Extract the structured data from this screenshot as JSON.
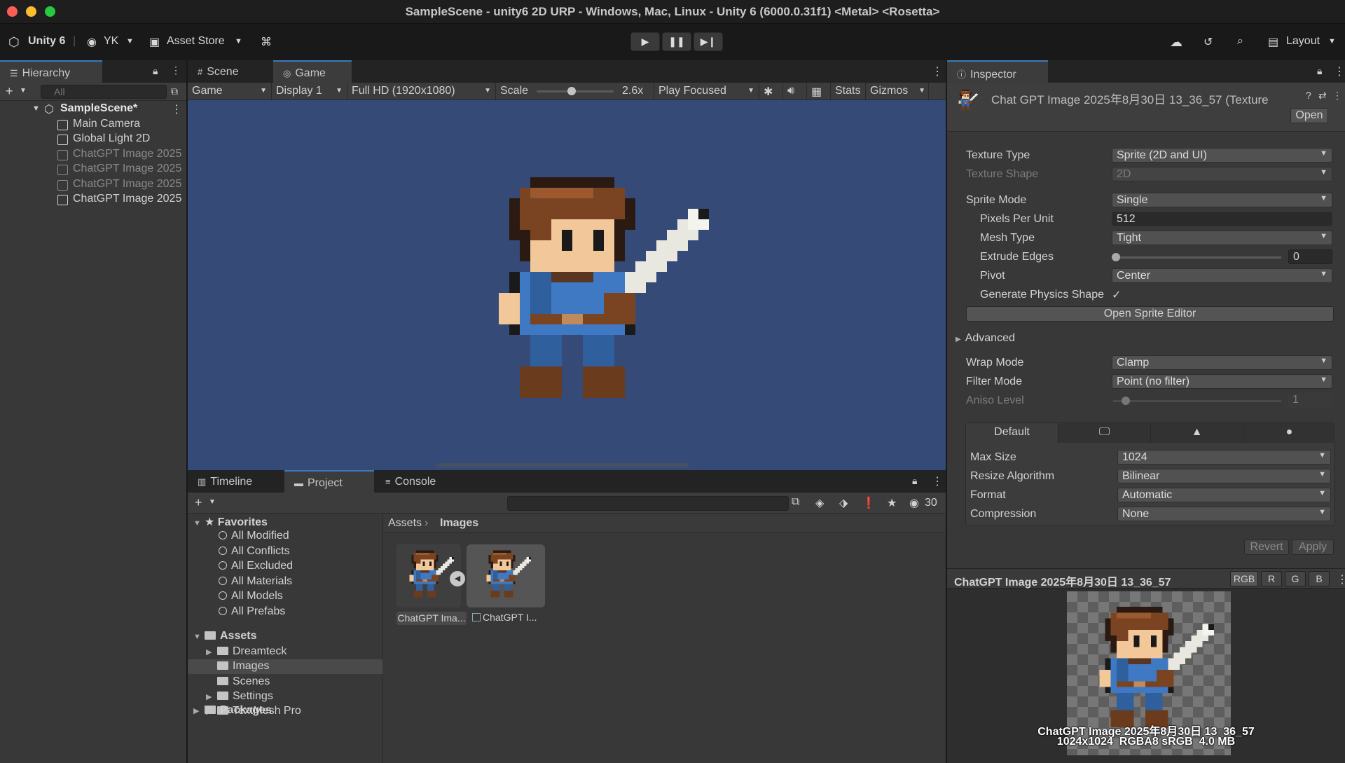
{
  "window": {
    "title": "SampleScene - unity6 2D URP - Windows, Mac, Linux - Unity 6 (6000.0.31f1) <Metal> <Rosetta>"
  },
  "toolbar": {
    "unity_label": "Unity 6",
    "account_label": "YK",
    "asset_store_label": "Asset Store",
    "layout_label": "Layout"
  },
  "hierarchy": {
    "tab_label": "Hierarchy",
    "search_placeholder": "All",
    "scene_name": "SampleScene*",
    "items": [
      {
        "label": "Main Camera",
        "dim": false
      },
      {
        "label": "Global Light 2D",
        "dim": false
      },
      {
        "label": "ChatGPT Image 2025",
        "dim": true
      },
      {
        "label": "ChatGPT Image 2025",
        "dim": true
      },
      {
        "label": "ChatGPT Image 2025",
        "dim": true
      },
      {
        "label": "ChatGPT Image 2025",
        "dim": false
      }
    ]
  },
  "center_tabs": {
    "scene": "Scene",
    "game": "Game"
  },
  "game_bar": {
    "view": "Game",
    "display": "Display 1",
    "resolution": "Full HD (1920x1080)",
    "scale_label": "Scale",
    "scale_value": "2.6x",
    "scale_fraction": 0.45,
    "play_mode": "Play Focused",
    "stats": "Stats",
    "gizmos": "Gizmos"
  },
  "bottom_tabs": {
    "timeline": "Timeline",
    "project": "Project",
    "console": "Console",
    "hidden_count": "30"
  },
  "project": {
    "favorites_label": "Favorites",
    "favorites": [
      "All Modified",
      "All Conflicts",
      "All Excluded",
      "All Materials",
      "All Models",
      "All Prefabs"
    ],
    "assets_label": "Assets",
    "folders": [
      {
        "label": "Dreamteck",
        "expandable": true
      },
      {
        "label": "Images",
        "expandable": false,
        "selected": true
      },
      {
        "label": "Scenes",
        "expandable": false
      },
      {
        "label": "Settings",
        "expandable": true
      },
      {
        "label": "TextMesh Pro",
        "expandable": true
      }
    ],
    "packages_label": "Packages",
    "breadcrumb": {
      "root": "Assets",
      "current": "Images"
    },
    "items": [
      {
        "label": "ChatGPT Ima..."
      },
      {
        "label": "ChatGPT I..."
      }
    ]
  },
  "inspector": {
    "tab_label": "Inspector",
    "asset_title": "Chat GPT Image 2025年8月30日 13_36_57 (Texture",
    "open_button": "Open",
    "rows": {
      "texture_type": {
        "label": "Texture Type",
        "value": "Sprite (2D and UI)"
      },
      "texture_shape": {
        "label": "Texture Shape",
        "value": "2D"
      },
      "sprite_mode": {
        "label": "Sprite Mode",
        "value": "Single"
      },
      "pixels_per_unit": {
        "label": "Pixels Per Unit",
        "value": "512"
      },
      "mesh_type": {
        "label": "Mesh Type",
        "value": "Tight"
      },
      "extrude_edges": {
        "label": "Extrude Edges",
        "value": "0"
      },
      "pivot": {
        "label": "Pivot",
        "value": "Center"
      },
      "gen_physics": {
        "label": "Generate Physics Shape",
        "value": "✓"
      },
      "wrap_mode": {
        "label": "Wrap Mode",
        "value": "Clamp"
      },
      "filter_mode": {
        "label": "Filter Mode",
        "value": "Point (no filter)"
      },
      "aniso_level": {
        "label": "Aniso Level",
        "value": "1"
      }
    },
    "open_sprite_editor": "Open Sprite Editor",
    "advanced_label": "Advanced",
    "platform_tab_default": "Default",
    "platform": {
      "max_size": {
        "label": "Max Size",
        "value": "1024"
      },
      "resize_algorithm": {
        "label": "Resize Algorithm",
        "value": "Bilinear"
      },
      "format": {
        "label": "Format",
        "value": "Automatic"
      },
      "compression": {
        "label": "Compression",
        "value": "None"
      }
    },
    "revert_button": "Revert",
    "apply_button": "Apply",
    "preview": {
      "title": "ChatGPT Image 2025年8月30日 13_36_57",
      "channels": [
        "RGB",
        "R",
        "G",
        "B"
      ],
      "caption_line1": "ChatGPT Image 2025年8月30日 13_36_57",
      "caption_line2": "1024x1024  RGBA8 sRGB  4.0 MB"
    }
  },
  "colors": {
    "accent": "#3a79bb",
    "game_bg": "#354a77",
    "panel": "#383838"
  }
}
